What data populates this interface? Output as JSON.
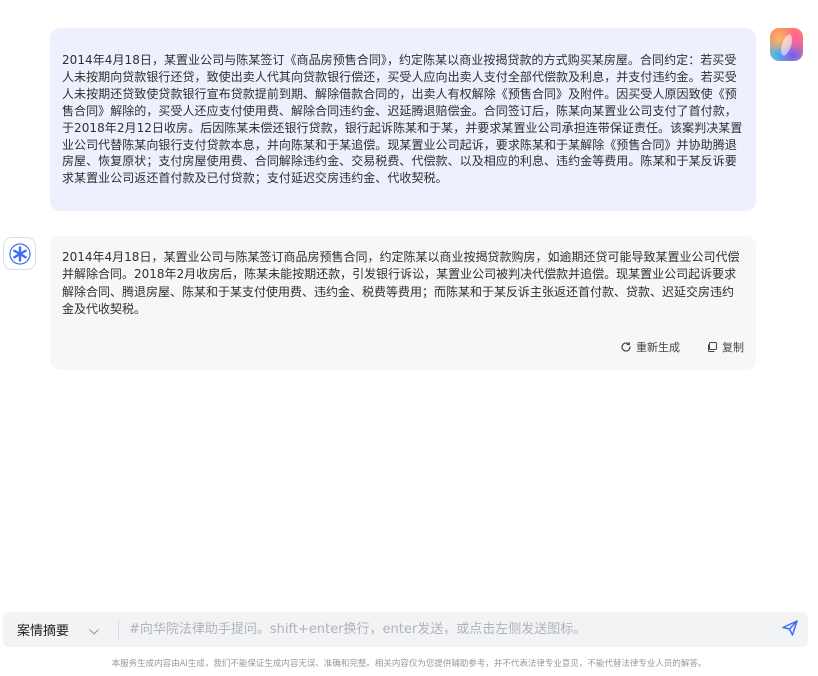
{
  "conversation": {
    "user_message": "2014年4月18日，某置业公司与陈某签订《商品房预售合同》，约定陈某以商业按揭贷款的方式购买某房屋。合同约定：若买受人未按期向贷款银行还贷，致使出卖人代其向贷款银行偿还，买受人应向出卖人支付全部代偿款及利息，并支付违约金。若买受人未按期还贷致使贷款银行宣布贷款提前到期、解除借款合同的，出卖人有权解除《预售合同》及附件。因买受人原因致使《预售合同》解除的，买受人还应支付使用费、解除合同违约金、迟延腾退赔偿金。合同签订后，陈某向某置业公司支付了首付款，于2018年2月12日收房。后因陈某未偿还银行贷款，银行起诉陈某和于某，并要求某置业公司承担连带保证责任。该案判决某置业公司代替陈某向银行支付贷款本息，并向陈某和于某追偿。现某置业公司起诉，要求陈某和于某解除《预售合同》并协助腾退房屋、恢复原状；支付房屋使用费、合同解除违约金、交易税费、代偿款、以及相应的利息、违约金等费用。陈某和于某反诉要求某置业公司返还首付款及已付贷款；支付延迟交房违约金、代收契税。",
    "bot_message": "2014年4月18日，某置业公司与陈某签订商品房预售合同，约定陈某以商业按揭贷款购房，如逾期还贷可能导致某置业公司代偿并解除合同。2018年2月收房后，陈某未能按期还款，引发银行诉讼，某置业公司被判决代偿款并追偿。现某置业公司起诉要求解除合同、腾退房屋、陈某和于某支付使用费、违约金、税费等费用；而陈某和于某反诉主张返还首付款、贷款、迟延交房违约金及代收契税。",
    "actions": {
      "regenerate_label": "重新生成",
      "copy_label": "复制"
    }
  },
  "input_bar": {
    "mode_label": "案情摘要",
    "placeholder": "#向华院法律助手提问。shift+enter换行，enter发送，或点击左侧发送图标。",
    "value": ""
  },
  "footer": {
    "disclaimer": "本服务生成内容由AI生成，我们不能保证生成内容无误、准确和完整。相关内容仅为您提供辅助参考，并不代表法律专业意见，不能代替法律专业人员的解答。"
  },
  "icons": {
    "user_avatar": "user-avatar-gradient",
    "bot_avatar": "asterisk-logo-icon",
    "regenerate": "refresh-icon",
    "copy": "copy-icon",
    "dropdown": "chevron-down-icon",
    "send": "send-icon"
  },
  "colors": {
    "user_bubble": "#edf1fd",
    "bot_bubble": "#f7f7f8",
    "accent": "#3b6ff5",
    "input_bg": "#f2f3f5"
  }
}
